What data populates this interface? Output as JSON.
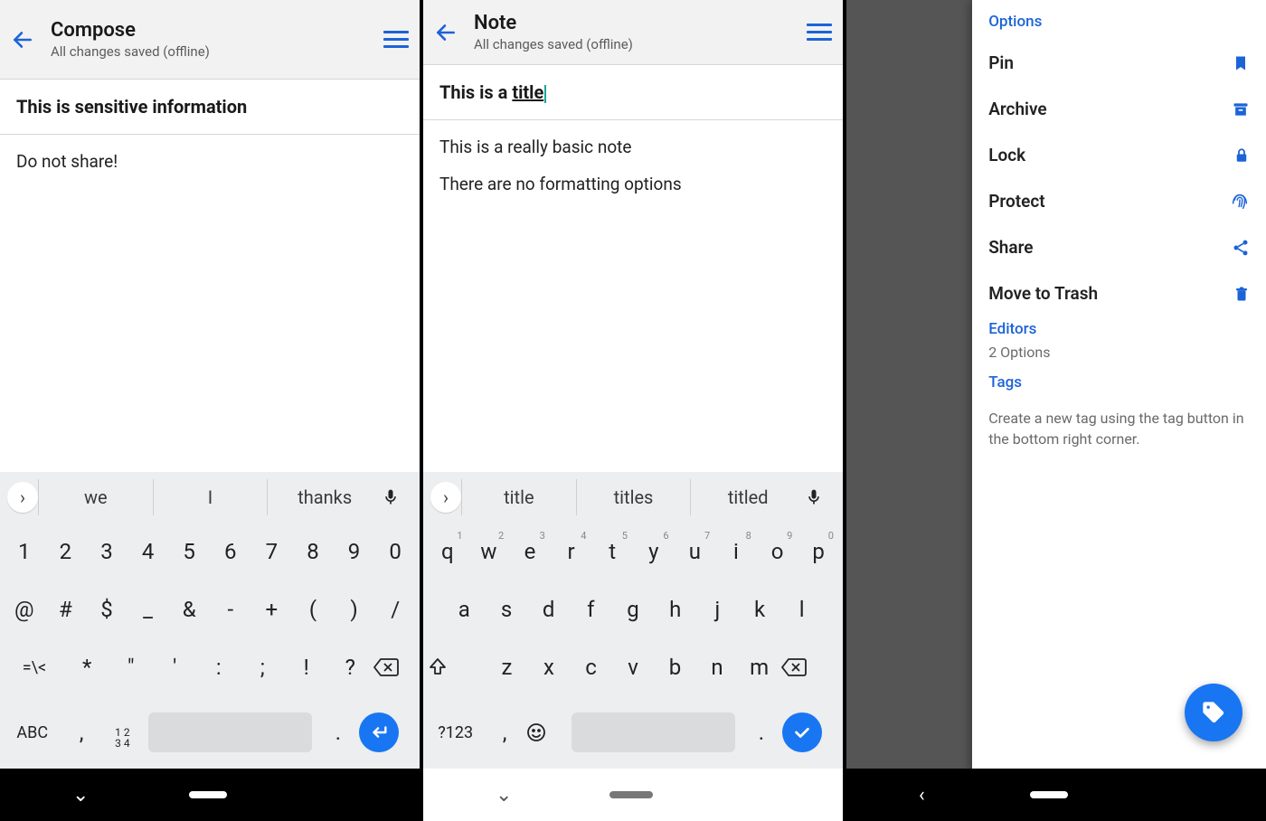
{
  "panel1": {
    "title": "Compose",
    "subtitle": "All changes saved (offline)",
    "noteTitle": "This is sensitive information",
    "body": [
      "Do not share!"
    ],
    "suggestions": [
      "we",
      "I",
      "thanks"
    ],
    "rows": {
      "r1": [
        "1",
        "2",
        "3",
        "4",
        "5",
        "6",
        "7",
        "8",
        "9",
        "0"
      ],
      "r2": [
        "@",
        "#",
        "$",
        "_",
        "&",
        "-",
        "+",
        "(",
        ")",
        "/"
      ],
      "r3": [
        "=\\<",
        "*",
        "\"",
        "'",
        ":",
        ";",
        "!",
        "?"
      ],
      "abc": "ABC",
      "comma": ",",
      "period": "."
    }
  },
  "panel2": {
    "title": "Note",
    "subtitle": "All changes saved (offline)",
    "noteTitlePrefix": "This is a ",
    "noteTitleUnderlined": "title",
    "body": [
      "This is a really basic note",
      "There are no formatting options"
    ],
    "suggestions": [
      "title",
      "titles",
      "titled"
    ],
    "rows": {
      "r1": [
        [
          "q",
          "1"
        ],
        [
          "w",
          "2"
        ],
        [
          "e",
          "3"
        ],
        [
          "r",
          "4"
        ],
        [
          "t",
          "5"
        ],
        [
          "y",
          "6"
        ],
        [
          "u",
          "7"
        ],
        [
          "i",
          "8"
        ],
        [
          "o",
          "9"
        ],
        [
          "p",
          "0"
        ]
      ],
      "r2": [
        "a",
        "s",
        "d",
        "f",
        "g",
        "h",
        "j",
        "k",
        "l"
      ],
      "r3": [
        "z",
        "x",
        "c",
        "v",
        "b",
        "n",
        "m"
      ],
      "sym": "?123",
      "comma": ",",
      "period": "."
    }
  },
  "panel3": {
    "headerOptions": "Options",
    "items": [
      {
        "label": "Pin",
        "icon": "bookmark"
      },
      {
        "label": "Archive",
        "icon": "archive"
      },
      {
        "label": "Lock",
        "icon": "lock"
      },
      {
        "label": "Protect",
        "icon": "fingerprint"
      },
      {
        "label": "Share",
        "icon": "share"
      },
      {
        "label": "Move to Trash",
        "icon": "trash"
      }
    ],
    "editorsLabel": "Editors",
    "editorsHint": "2 Options",
    "tagsLabel": "Tags",
    "tagsHint": "Create a new tag using the tag button in the bottom right corner."
  }
}
